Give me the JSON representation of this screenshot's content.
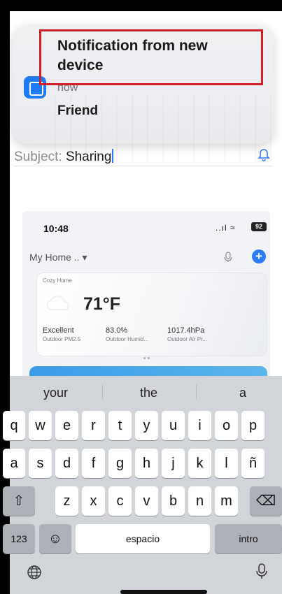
{
  "notification": {
    "title": "Notification from new device",
    "time": "now",
    "body": "Friend"
  },
  "mail": {
    "subject_label": "Subject:",
    "subject_value": "Sharing"
  },
  "screenshot": {
    "time": "10:48",
    "signal": "..ıl ≈",
    "battery": "92",
    "home_label": "My Home .. ▾",
    "weather": {
      "home_name": "Cozy Home",
      "temperature": "71°F",
      "metrics": [
        {
          "value": "Excellent",
          "label": "Outdoor PM2.5"
        },
        {
          "value": "83.0%",
          "label": "Outdoor Humid..."
        },
        {
          "value": "1017.4hPa",
          "label": "Outdoor Air Pr..."
        }
      ]
    }
  },
  "keyboard": {
    "suggestions": [
      "your",
      "the",
      "a"
    ],
    "row1": [
      "q",
      "w",
      "e",
      "r",
      "t",
      "y",
      "u",
      "i",
      "o",
      "p"
    ],
    "row2": [
      "a",
      "s",
      "d",
      "f",
      "g",
      "h",
      "j",
      "k",
      "l",
      "ñ"
    ],
    "row3": [
      "z",
      "x",
      "c",
      "v",
      "b",
      "n",
      "m"
    ],
    "shift": "⇧",
    "delete": "⌫",
    "numbers": "123",
    "emoji": "☺",
    "space": "espacio",
    "return": "intro"
  }
}
